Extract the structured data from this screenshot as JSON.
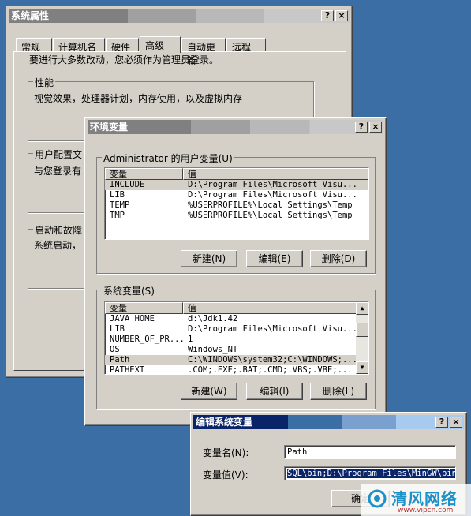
{
  "sysprops": {
    "title": "系统属性",
    "help_btn": "?",
    "close_btn": "×",
    "tabs": [
      "常规",
      "计算机名",
      "硬件",
      "高级",
      "自动更新",
      "远程"
    ],
    "admin_note": "要进行大多数改动，您必须作为管理员登录。",
    "perf_group": "性能",
    "perf_desc": "视觉效果，处理器计划，内存使用，以及虚拟内存",
    "profile_group": "用户配置文",
    "profile_desc": "与您登录有",
    "startup_group": "启动和故障",
    "startup_desc": "系统启动，"
  },
  "envvars": {
    "title": "环境变量",
    "help_btn": "?",
    "close_btn": "×",
    "user_group": "Administrator 的用户变量(U)",
    "col_var": "变量",
    "col_val": "值",
    "user_rows": [
      {
        "name": "INCLUDE",
        "value": "D:\\Program Files\\Microsoft Visu..."
      },
      {
        "name": "LIB",
        "value": "D:\\Program Files\\Microsoft Visu..."
      },
      {
        "name": "TEMP",
        "value": "%USERPROFILE%\\Local Settings\\Temp"
      },
      {
        "name": "TMP",
        "value": "%USERPROFILE%\\Local Settings\\Temp"
      }
    ],
    "user_new": "新建(N)",
    "user_edit": "编辑(E)",
    "user_delete": "删除(D)",
    "sys_group": "系统变量(S)",
    "sys_rows": [
      {
        "name": "JAVA_HOME",
        "value": "d:\\Jdk1.42"
      },
      {
        "name": "LIB",
        "value": "D:\\Program Files\\Microsoft Visu..."
      },
      {
        "name": "NUMBER_OF_PR...",
        "value": "1"
      },
      {
        "name": "OS",
        "value": "Windows_NT"
      },
      {
        "name": "Path",
        "value": "C:\\WINDOWS\\system32;C:\\WINDOWS;..."
      },
      {
        "name": "PATHEXT",
        "value": ".COM;.EXE;.BAT;.CMD;.VBS;.VBE;..."
      }
    ],
    "sys_new": "新建(W)",
    "sys_edit": "编辑(I)",
    "sys_delete": "删除(L)"
  },
  "editvar": {
    "title": "编辑系统变量",
    "help_btn": "?",
    "close_btn": "×",
    "name_label": "变量名(N):",
    "name_value": "Path",
    "value_label": "变量值(V):",
    "value_value": "SQL\\bin;D:\\Program Files\\MinGW\\bin;",
    "ok": "确定"
  },
  "watermark": {
    "brand": "清风网络",
    "url": "www.vipcn.com"
  }
}
